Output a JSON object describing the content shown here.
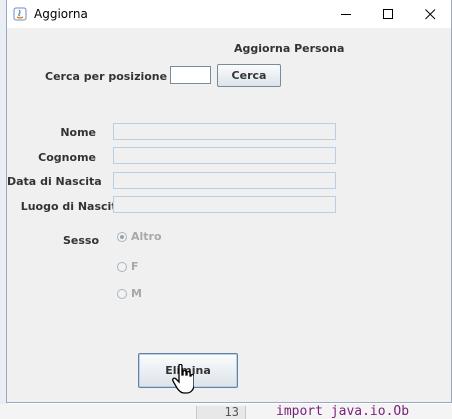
{
  "window": {
    "title": "Aggiorna"
  },
  "form": {
    "heading": "Aggiorna Persona",
    "search_label": "Cerca per posizione",
    "search_value": "",
    "search_button": "Cerca",
    "fields": [
      {
        "label": "Nome",
        "value": ""
      },
      {
        "label": "Cognome",
        "value": ""
      },
      {
        "label": "Data di Nascita",
        "value": ""
      },
      {
        "label": "Luogo di Nascita",
        "value": ""
      }
    ],
    "sex_label": "Sesso",
    "sex_options": [
      {
        "label": "Altro",
        "selected": true
      },
      {
        "label": "F",
        "selected": false
      },
      {
        "label": "M",
        "selected": false
      }
    ],
    "delete_button": "Elimina"
  },
  "background": {
    "line_number": "13",
    "code_fragment": "import java.io.Ob"
  }
}
